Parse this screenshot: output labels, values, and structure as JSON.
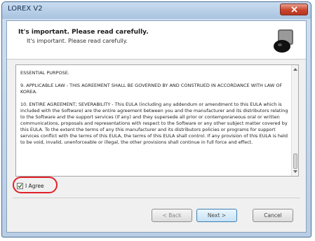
{
  "window": {
    "title": "LOREX V2"
  },
  "header": {
    "heading": "It's important. Please read carefully.",
    "subheading": "It's important. Please read carefully."
  },
  "license": {
    "paragraphs": [
      "ESSENTIAL PURPOSE.",
      "9. APPLICABLE LAW - THIS AGREEMENT SHALL BE GOVERNED BY AND CONSTRUED IN ACCORDANCE WITH LAW OF KOREA.",
      "10. ENTIRE AGREEMENT; SEVERABILITY - This EULA (including any addendum or amendment to this EULA which is included with the Software) are the entire agreement between you and the manufacturer and its distributors relating to the Software and the support services (if any) and they supersede all prior or contemporaneous oral or written communications, proposals and representations with respect to the Software or any other subject matter covered by this EULA. To the extent the terms of any this manufacturer and its distributors policies or programs for support services conflict with the terms of this EULA, the terms of this EULA shall control. If any provision of this EULA is held to be void, invalid, unenforceable or illegal, the other provisions shall continue in full force and effect."
    ]
  },
  "agree": {
    "label": "I Agree"
  },
  "buttons": {
    "back": "< Back",
    "next": "Next >",
    "cancel": "Cancel"
  },
  "colors": {
    "highlight": "#e0212a",
    "title_bar": "#b9cde4",
    "close_button": "#c9442c"
  },
  "icons": {
    "close": "close-icon",
    "product": "camera-lens-icon",
    "scroll_up": "scroll-up-arrow-icon",
    "scroll_down": "scroll-down-arrow-icon",
    "check": "checkmark-icon"
  }
}
